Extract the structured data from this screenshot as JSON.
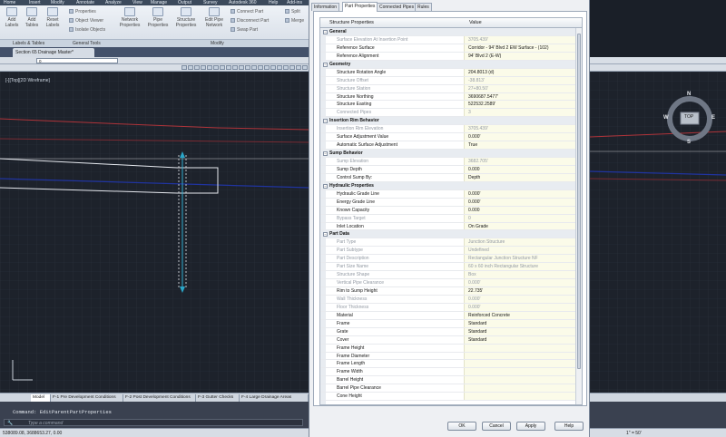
{
  "ribbon": {
    "tabs": [
      "Home",
      "Insert",
      "Modify",
      "Annotate",
      "Analyze",
      "View",
      "Manage",
      "Output",
      "Survey",
      "Autodesk 360",
      "Help",
      "Add-ins"
    ],
    "labels_panel": {
      "add_labels": "Add Labels",
      "add_tables": "Add Tables",
      "reset_labels": "Reset Labels",
      "name": "Labels & Tables"
    },
    "general_tools": {
      "items": [
        "Properties",
        "Object Viewer",
        "Isolate Objects"
      ],
      "name": "General Tools"
    },
    "modify_panel": {
      "buttons": [
        "Network Properties",
        "Pipe Properties",
        "Structure Properties",
        "Edit Pipe Network"
      ],
      "small": [
        "Connect Part",
        "Disconnect Part",
        "Swap Part"
      ],
      "extra": [
        "Split",
        "Merge"
      ],
      "name": "Modify"
    }
  },
  "document": {
    "tab_title": "Section 65 Drainage Master*",
    "layer_value": "0"
  },
  "viewport": {
    "label": "[-][Top][2D Wireframe]"
  },
  "viewcube": {
    "top": "TOP",
    "n": "N",
    "s": "S",
    "e": "E",
    "w": "W"
  },
  "layout_tabs": [
    "Model",
    "F-1 Pre Development Conditions",
    "F-2 Post Development Conditions",
    "F-3 Gutter Checks",
    "F-4 Large Drainage Areas"
  ],
  "command": {
    "history": "Command: EditParentPartProperties",
    "placeholder": "Type a command"
  },
  "status": {
    "coords": "538089.08, 3688653.27, 0.00",
    "scale": "1\" = 50'"
  },
  "dialog": {
    "tabs": [
      "Information",
      "Part Properties",
      "Connected Pipes",
      "Rules"
    ],
    "active_tab": "Part Properties",
    "columns": {
      "name": "Structure Properties",
      "value": "Value"
    },
    "rows": [
      {
        "type": "cat",
        "name": "General"
      },
      {
        "type": "ro",
        "name": "Surface Elevation At Insertion Point",
        "value": "3705.439'"
      },
      {
        "type": "rw",
        "name": "Reference Surface",
        "value": "Corridor - 94' Blvd 2 EW Surface - (102)"
      },
      {
        "type": "rw",
        "name": "Reference Alignment",
        "value": "94' Blvd 2 (E-W)"
      },
      {
        "type": "cat",
        "name": "Geometry"
      },
      {
        "type": "rw",
        "name": "Structure Rotation Angle",
        "value": "204.8013 (d)"
      },
      {
        "type": "ro",
        "name": "Structure Offset",
        "value": "-38.813'"
      },
      {
        "type": "ro",
        "name": "Structure Station",
        "value": "27+80.50'"
      },
      {
        "type": "rw",
        "name": "Structure Northing",
        "value": "3690687.5477'"
      },
      {
        "type": "rw",
        "name": "Structure Easting",
        "value": "522532.2589'"
      },
      {
        "type": "ro",
        "name": "Connected Pipes",
        "value": "3"
      },
      {
        "type": "cat",
        "name": "Insertion Rim Behavior"
      },
      {
        "type": "ro",
        "name": "Insertion Rim Elevation",
        "value": "3705.439'"
      },
      {
        "type": "rw",
        "name": "Surface Adjustment Value",
        "value": "0.000'"
      },
      {
        "type": "rw",
        "name": "Automatic Surface Adjustment",
        "value": "True"
      },
      {
        "type": "cat",
        "name": "Sump Behavior"
      },
      {
        "type": "ro",
        "name": "Sump Elevation",
        "value": "3682.705'"
      },
      {
        "type": "rw",
        "name": "Sump Depth",
        "value": "0.000"
      },
      {
        "type": "rw",
        "name": "Control Sump By:",
        "value": "Depth"
      },
      {
        "type": "cat",
        "name": "Hydraulic Properties"
      },
      {
        "type": "rw",
        "name": "Hydraulic Grade Line",
        "value": "0.000'"
      },
      {
        "type": "rw",
        "name": "Energy Grade Line",
        "value": "0.000'"
      },
      {
        "type": "rw",
        "name": "Known Capacity",
        "value": "0.000"
      },
      {
        "type": "ro",
        "name": "Bypass Target",
        "value": "0"
      },
      {
        "type": "rw",
        "name": "Inlet Location",
        "value": "On Grade"
      },
      {
        "type": "cat",
        "name": "Part Data"
      },
      {
        "type": "ro",
        "name": "Part Type",
        "value": "Junction Structure"
      },
      {
        "type": "ro",
        "name": "Part Subtype",
        "value": "Undefined"
      },
      {
        "type": "ro",
        "name": "Part Description",
        "value": "Rectangular Junction Structure NF"
      },
      {
        "type": "ro",
        "name": "Part Size Name",
        "value": "60 x 60 inch Rectangular Structure"
      },
      {
        "type": "ro",
        "name": "Structure Shape",
        "value": "Box"
      },
      {
        "type": "ro",
        "name": "Vertical Pipe Clearance",
        "value": "0.000'"
      },
      {
        "type": "rw",
        "name": "Rim to Sump Height",
        "value": "22.735'"
      },
      {
        "type": "ro",
        "name": "Wall Thickness",
        "value": "0.000'"
      },
      {
        "type": "ro",
        "name": "Floor Thickness",
        "value": "0.000'"
      },
      {
        "type": "rw",
        "name": "Material",
        "value": "Reinforced Concrete"
      },
      {
        "type": "rw",
        "name": "Frame",
        "value": "Standard"
      },
      {
        "type": "rw",
        "name": "Grate",
        "value": "Standard"
      },
      {
        "type": "rw",
        "name": "Cover",
        "value": "Standard"
      },
      {
        "type": "rw",
        "name": "Frame Height",
        "value": ""
      },
      {
        "type": "rw",
        "name": "Frame Diameter",
        "value": ""
      },
      {
        "type": "rw",
        "name": "Frame Length",
        "value": ""
      },
      {
        "type": "rw",
        "name": "Frame Width",
        "value": ""
      },
      {
        "type": "rw",
        "name": "Barrel Height",
        "value": ""
      },
      {
        "type": "rw",
        "name": "Barrel Pipe Clearance",
        "value": ""
      },
      {
        "type": "rw",
        "name": "Cone Height",
        "value": ""
      }
    ],
    "buttons": {
      "ok": "OK",
      "cancel": "Cancel",
      "apply": "Apply",
      "help": "Help"
    }
  }
}
